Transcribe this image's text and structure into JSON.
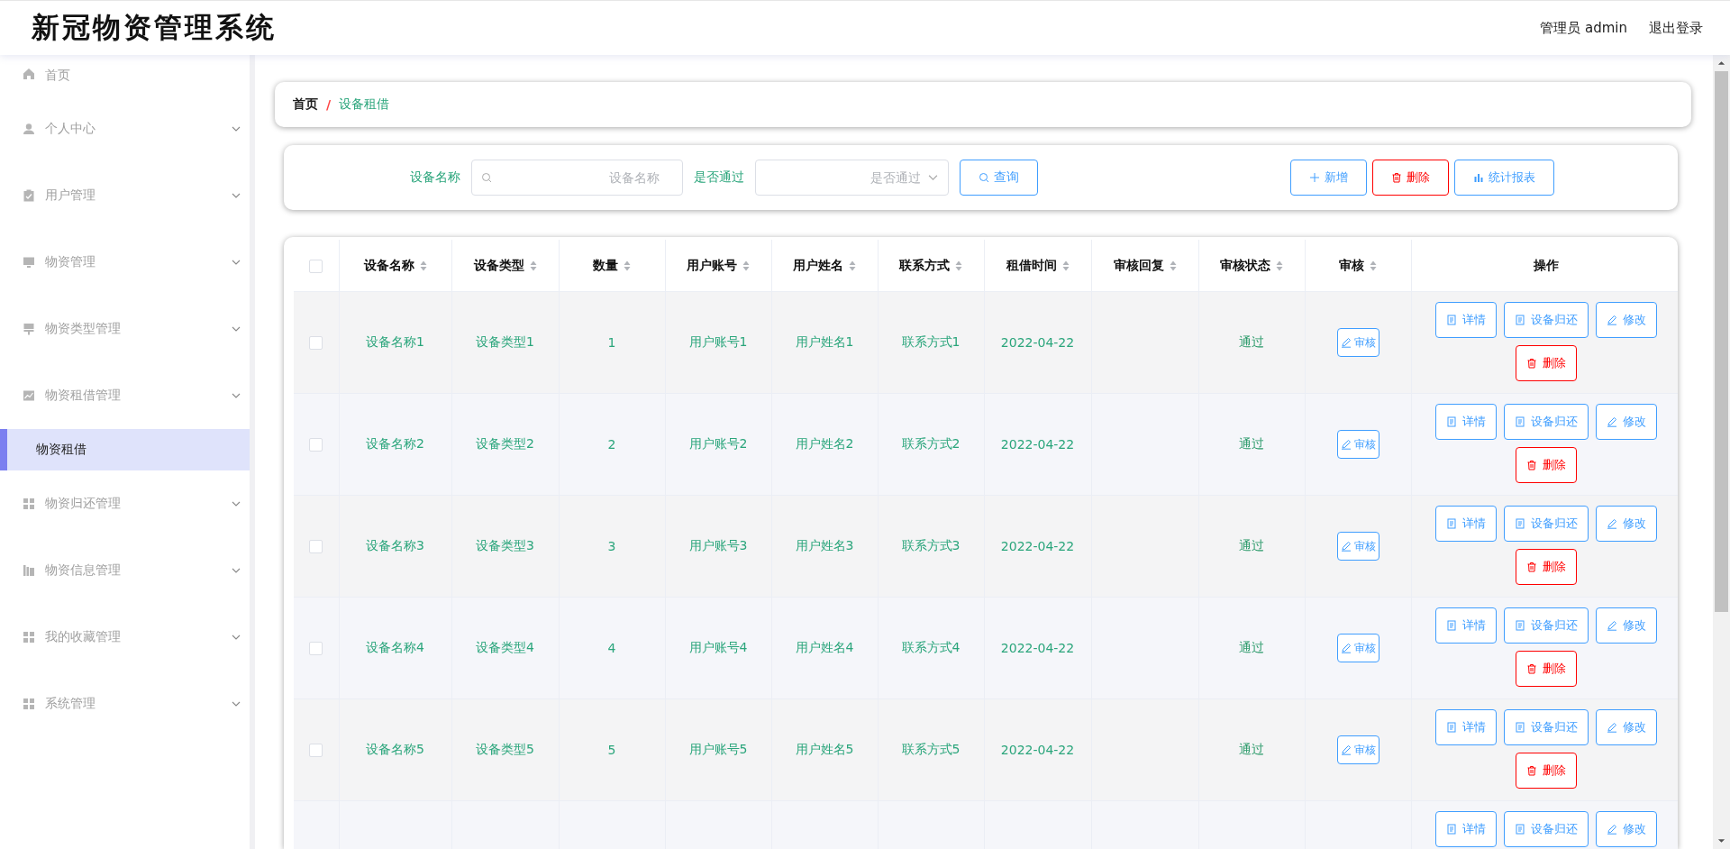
{
  "header": {
    "title": "新冠物资管理系统",
    "user": "管理员 admin",
    "logout": "退出登录"
  },
  "sidebar": {
    "items": [
      {
        "label": "首页",
        "kind": "link"
      },
      {
        "label": "个人中心",
        "kind": "menu"
      },
      {
        "label": "用户管理",
        "kind": "menu"
      },
      {
        "label": "物资管理",
        "kind": "menu"
      },
      {
        "label": "物资类型管理",
        "kind": "menu"
      },
      {
        "label": "物资租借管理",
        "kind": "menu",
        "children": [
          {
            "label": "物资租借",
            "selected": true
          }
        ]
      },
      {
        "label": "物资归还管理",
        "kind": "menu"
      },
      {
        "label": "物资信息管理",
        "kind": "menu"
      },
      {
        "label": "我的收藏管理",
        "kind": "menu"
      },
      {
        "label": "系统管理",
        "kind": "menu"
      }
    ]
  },
  "breadcrumb": {
    "items": [
      "首页",
      "设备租借"
    ],
    "separator": "/"
  },
  "search": {
    "fields": [
      {
        "label": "设备名称",
        "placeholder": "设备名称",
        "kind": "text"
      },
      {
        "label": "是否通过",
        "placeholder": "是否通过",
        "kind": "select"
      }
    ],
    "query_button": "查询",
    "actions": [
      {
        "label": "新增",
        "kind": "add"
      },
      {
        "label": "删除",
        "kind": "delete"
      },
      {
        "label": "统计报表",
        "kind": "report"
      }
    ]
  },
  "table": {
    "select_all_checked": false,
    "columns": [
      {
        "label": "设备名称",
        "sortable": true
      },
      {
        "label": "设备类型",
        "sortable": true
      },
      {
        "label": "数量",
        "sortable": true
      },
      {
        "label": "用户账号",
        "sortable": true
      },
      {
        "label": "用户姓名",
        "sortable": true
      },
      {
        "label": "联系方式",
        "sortable": true
      },
      {
        "label": "租借时间",
        "sortable": true
      },
      {
        "label": "审核回复",
        "sortable": true
      },
      {
        "label": "审核状态",
        "sortable": true
      },
      {
        "label": "审核",
        "sortable": true
      },
      {
        "label": "操作",
        "sortable": false
      }
    ],
    "rows": [
      {
        "checked": false,
        "cells": [
          "设备名称1",
          "设备类型1",
          "1",
          "用户账号1",
          "用户姓名1",
          "联系方式1",
          "2022-04-22"
        ],
        "status": "通过",
        "review_button": "审核",
        "actions": [
          {
            "label": "详情",
            "kind": "detail"
          },
          {
            "label": "设备归还",
            "kind": "return"
          },
          {
            "label": "修改",
            "kind": "edit"
          },
          {
            "label": "删除",
            "kind": "delete"
          }
        ]
      },
      {
        "checked": false,
        "cells": [
          "设备名称2",
          "设备类型2",
          "2",
          "用户账号2",
          "用户姓名2",
          "联系方式2",
          "2022-04-22"
        ],
        "status": "通过",
        "review_button": "审核",
        "actions": [
          {
            "label": "详情",
            "kind": "detail"
          },
          {
            "label": "设备归还",
            "kind": "return"
          },
          {
            "label": "修改",
            "kind": "edit"
          },
          {
            "label": "删除",
            "kind": "delete"
          }
        ]
      },
      {
        "checked": false,
        "cells": [
          "设备名称3",
          "设备类型3",
          "3",
          "用户账号3",
          "用户姓名3",
          "联系方式3",
          "2022-04-22"
        ],
        "status": "通过",
        "review_button": "审核",
        "actions": [
          {
            "label": "详情",
            "kind": "detail"
          },
          {
            "label": "设备归还",
            "kind": "return"
          },
          {
            "label": "修改",
            "kind": "edit"
          },
          {
            "label": "删除",
            "kind": "delete"
          }
        ]
      },
      {
        "checked": false,
        "cells": [
          "设备名称4",
          "设备类型4",
          "4",
          "用户账号4",
          "用户姓名4",
          "联系方式4",
          "2022-04-22"
        ],
        "status": "通过",
        "review_button": "审核",
        "actions": [
          {
            "label": "详情",
            "kind": "detail"
          },
          {
            "label": "设备归还",
            "kind": "return"
          },
          {
            "label": "修改",
            "kind": "edit"
          },
          {
            "label": "删除",
            "kind": "delete"
          }
        ]
      },
      {
        "checked": false,
        "cells": [
          "设备名称5",
          "设备类型5",
          "5",
          "用户账号5",
          "用户姓名5",
          "联系方式5",
          "2022-04-22"
        ],
        "status": "通过",
        "review_button": "审核",
        "actions": [
          {
            "label": "详情",
            "kind": "detail"
          },
          {
            "label": "设备归还",
            "kind": "return"
          },
          {
            "label": "修改",
            "kind": "edit"
          },
          {
            "label": "删除",
            "kind": "delete"
          }
        ]
      },
      {
        "actions": [
          {
            "label": "详情",
            "kind": "detail"
          },
          {
            "label": "设备归还",
            "kind": "return"
          },
          {
            "label": "修改",
            "kind": "edit"
          }
        ]
      }
    ]
  }
}
